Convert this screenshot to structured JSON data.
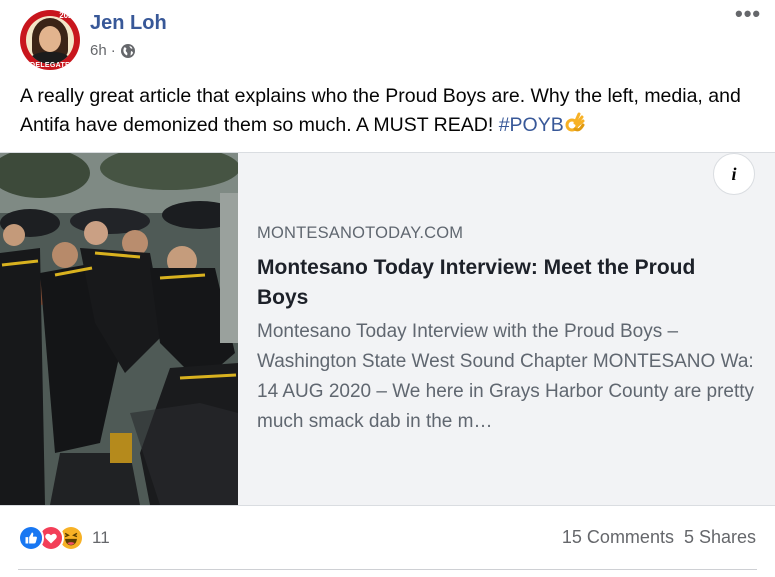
{
  "post": {
    "author": "Jen Loh",
    "time": "6h",
    "time_separator": "·",
    "visibility_icon": "globe-icon",
    "more_icon": "more-options-icon",
    "more_label": "•••",
    "avatar": {
      "badge_top": "2020",
      "badge_bottom": "DELEGATE"
    },
    "text_main": "A really great article that explains who the Proud Boys are. Why the left, media, and Antifa have demonized them so much. A MUST READ! ",
    "hashtag": "#POYB",
    "emoji": "ok-hand-emoji"
  },
  "link_card": {
    "domain": "MONTESANOTODAY.COM",
    "title": "Montesano Today Interview: Meet the Proud Boys",
    "description": "Montesano Today Interview with the Proud Boys – Washington State West Sound Chapter MONTESANO Wa: 14 AUG 2020 – We here in Grays Harbor County are pretty much smack dab in the m…",
    "info_label": "i",
    "thumbnail_icon": "article-photo-thumbnail"
  },
  "footer": {
    "reactions": [
      "like-icon",
      "love-icon",
      "haha-icon"
    ],
    "reaction_count": "11",
    "comments": "15 Comments",
    "shares": "5 Shares"
  },
  "colors": {
    "link_blue": "#385898",
    "like_blue": "#1877f2",
    "love_red": "#f33e58",
    "haha_yellow": "#f7b125",
    "card_bg": "#f2f3f5",
    "secondary_text": "#65676b"
  }
}
